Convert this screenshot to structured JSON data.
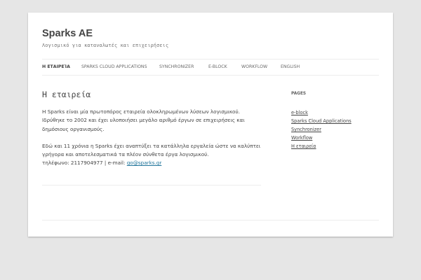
{
  "site": {
    "title": "Sparks AE",
    "description": "Λογισμικό για καταναλωτές και επιχειρήσεις"
  },
  "nav": {
    "items": [
      {
        "label": "Η εταιρεία",
        "active": true
      },
      {
        "label": "Sparks Cloud Applications",
        "active": false
      },
      {
        "label": "Synchronizer",
        "active": false
      },
      {
        "label": "E-block",
        "active": false
      },
      {
        "label": "Workflow",
        "active": false
      },
      {
        "label": "English",
        "active": false
      }
    ]
  },
  "entry": {
    "title": "Η εταιρεία",
    "paragraph1": "Η Sparks είναι μία πρωτοπόρος εταιρεία ολοκληρωμένων λύσεων λογισμικού. Ιδρύθηκε το 2002 και έχει υλοποιήσει μεγάλο αριθμό έργων σε επιχειρήσεις και δημόσιους οργανισμούς.",
    "paragraph2": "Εδώ και 11 χρόνια η Sparks έχει αναπτύξει τα κατάλληλα εργαλεία ώστε να καλύπτει γρήγορα και αποτελεσματικά τα πλέον σύνθετα έργα λογισμικού.",
    "phone_line": "τηλέφωνο: 2117904977 | e-mail: ",
    "email": "go@sparks.gr"
  },
  "sidebar": {
    "widget_title": "Pages",
    "items": [
      {
        "label": "e-block"
      },
      {
        "label": "Sparks Cloud Applications"
      },
      {
        "label": "Synchronizer"
      },
      {
        "label": "Workflow"
      },
      {
        "label": "Η εταιρεία"
      }
    ]
  }
}
